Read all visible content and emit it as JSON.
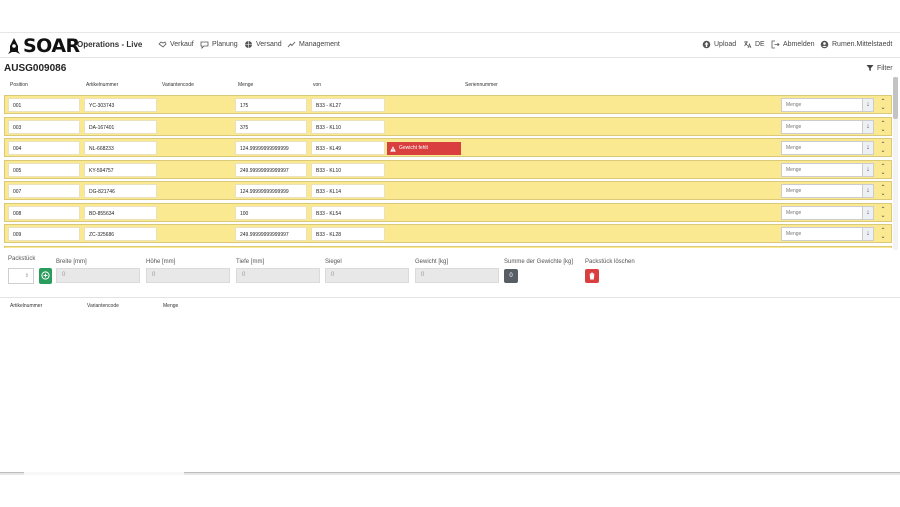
{
  "app": {
    "logo_text": "SOAR",
    "title": "Operations - Live"
  },
  "nav": {
    "verkauf": "Verkauf",
    "planung": "Planung",
    "versand": "Versand",
    "management": "Management",
    "upload": "Upload",
    "lang": "DE",
    "abmelden": "Abmelden",
    "user": "Rumen.Mittelstaedt"
  },
  "order": {
    "id": "AUSG009086",
    "filter_label": "Filter"
  },
  "table": {
    "headers": {
      "position": "Position",
      "artikelnummer": "Artikelnummer",
      "variantencode": "Variantencode",
      "menge": "Menge",
      "von": "von",
      "seriennummer": "Seriennummer"
    },
    "menge_placeholder": "Menge",
    "rows": [
      {
        "position": "001",
        "artikel": "YC-303743",
        "menge": "175",
        "von": "B33 - KL27",
        "warning": ""
      },
      {
        "position": "003",
        "artikel": "DA-167401",
        "menge": "375",
        "von": "B33 - KL10",
        "warning": ""
      },
      {
        "position": "004",
        "artikel": "NL-668233",
        "menge": "124.99999999999999",
        "von": "B33 - KL49",
        "warning": "Gewicht fehlt"
      },
      {
        "position": "005",
        "artikel": "KY-594757",
        "menge": "249.99999999999997",
        "von": "B33 - KL10",
        "warning": ""
      },
      {
        "position": "007",
        "artikel": "DG-821746",
        "menge": "124.99999999999999",
        "von": "B33 - KL14",
        "warning": ""
      },
      {
        "position": "008",
        "artikel": "BD-855634",
        "menge": "100",
        "von": "B33 - KL54",
        "warning": ""
      },
      {
        "position": "009",
        "artikel": "ZC-325686",
        "menge": "249.99999999999997",
        "von": "B33 - KL28",
        "warning": ""
      }
    ]
  },
  "packstueck": {
    "label": "Packstück",
    "breite_label": "Breite [mm]",
    "hoehe_label": "Höhe [mm]",
    "tiefe_label": "Tiefe [mm]",
    "siegel_label": "Siegel",
    "gewicht_label": "Gewicht [kg]",
    "summe_label": "Summe der Gewichte [kg]",
    "loeschen_label": "Packstück löschen",
    "breite_value": "0",
    "hoehe_value": "0",
    "tiefe_value": "0",
    "siegel_value": "0",
    "gewicht_value": "0",
    "summe_value": "0"
  },
  "content_table": {
    "headers": {
      "artikelnummer": "Artikelnummer",
      "variantencode": "Variantencode",
      "menge": "Menge"
    }
  },
  "colors": {
    "row_highlight": "#fbe991",
    "warning": "#d93f3f",
    "add_button": "#2a9d5c",
    "summe_badge": "#595e66"
  }
}
